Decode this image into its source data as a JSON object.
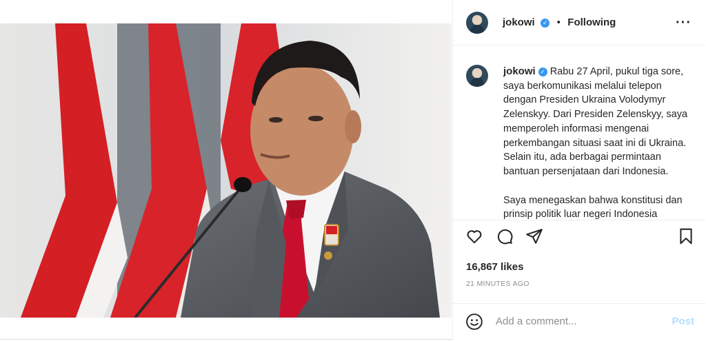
{
  "post": {
    "username": "jokowi",
    "separator": "•",
    "follow_status": "Following",
    "more_icon": "more-horizontal-icon",
    "caption_paragraphs": [
      "Rabu 27 April, pukul tiga sore, saya berkomunikasi melalui telepon dengan Presiden Ukraina Volodymyr Zelenskyy. Dari Presiden Zelenskyy, saya memperoleh informasi mengenai perkembangan situasi saat ini di Ukraina. Selain itu, ada berbagai permintaan bantuan persenjataan dari Indonesia.",
      "Saya menegaskan bahwa konstitusi dan prinsip politik luar negeri Indonesia"
    ],
    "likes": "16,867 likes",
    "timestamp": "21 MINUTES AGO"
  },
  "actions": {
    "icons": [
      "heart-icon",
      "comment-icon",
      "share-icon",
      "bookmark-icon"
    ]
  },
  "comment": {
    "emoji_icon": "emoji-icon",
    "placeholder": "Add a comment...",
    "post_label": "Post"
  },
  "colors": {
    "verified": "#3897f0",
    "muted": "#8e8e8e",
    "post_disabled": "#b2dffc",
    "flag_red": "#d41f25",
    "suit": "#5a5e63",
    "tie": "#c8102e"
  }
}
